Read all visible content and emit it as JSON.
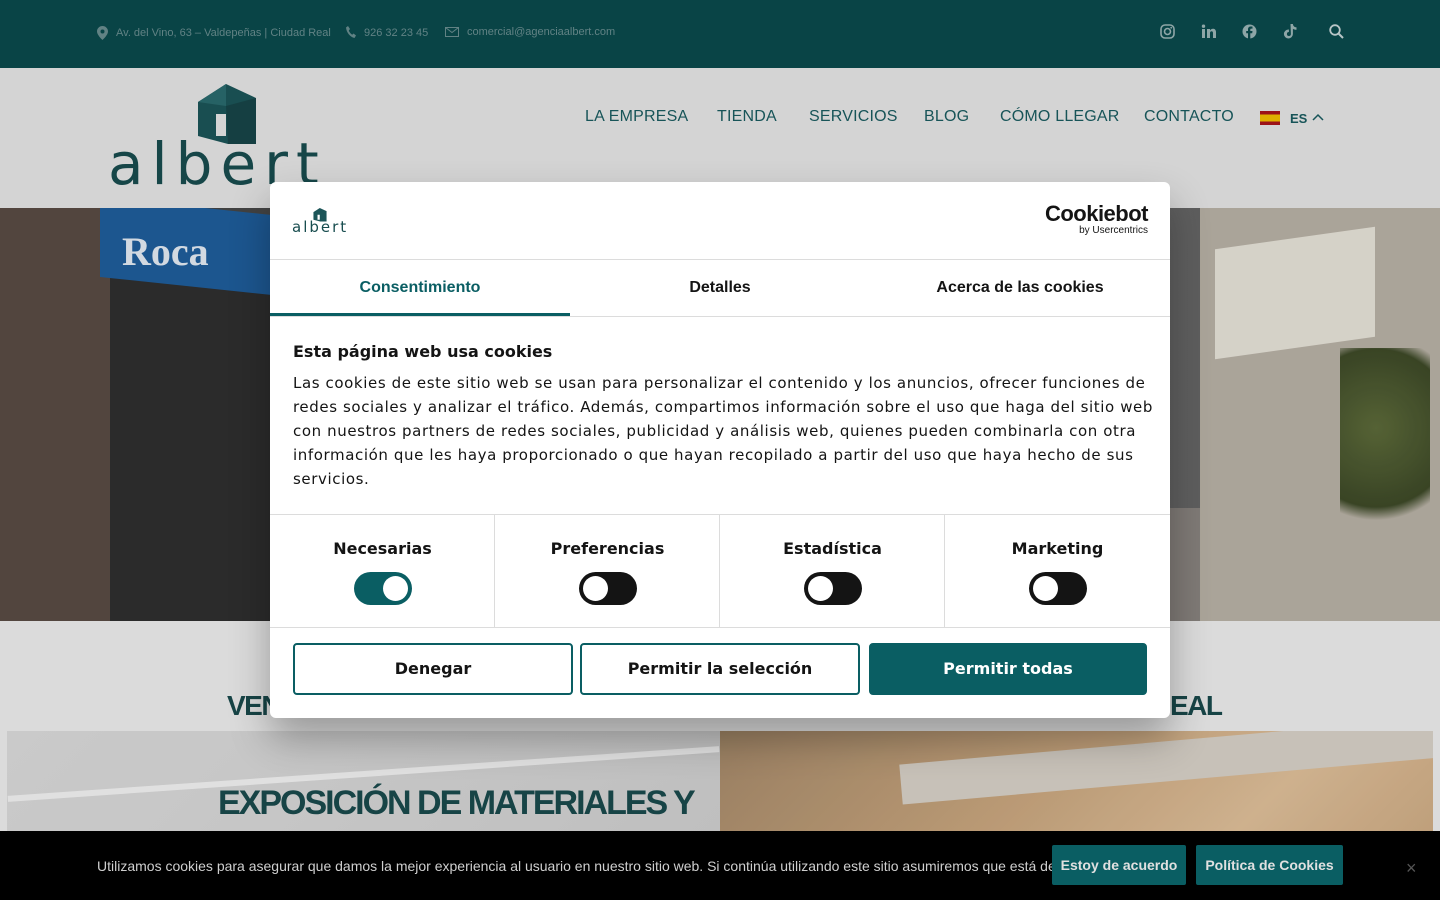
{
  "topbar": {
    "address": "Av. del Vino, 63 – Valdepeñas | Ciudad Real",
    "phone": "926 32 23 45",
    "email": "comercial@agenciaalbert.com",
    "social_icons": [
      "instagram-icon",
      "linkedin-icon",
      "facebook-icon",
      "tiktok-icon",
      "search-icon"
    ]
  },
  "header": {
    "logo_text": "albert",
    "nav": [
      "LA EMPRESA",
      "TIENDA",
      "SERVICIOS",
      "BLOG",
      "CÓMO LLEGAR",
      "CONTACTO"
    ],
    "language": "ES"
  },
  "hero": {
    "sign_text": "Roca"
  },
  "section": {
    "title_left": "VEN",
    "title_right": "EAL",
    "tile_title": "EXPOSICIÓN DE MATERIALES Y"
  },
  "dialog": {
    "logo_text": "albert",
    "brand_main": "Cookiebot",
    "brand_sub": "by Usercentrics",
    "tabs": [
      "Consentimiento",
      "Detalles",
      "Acerca de las cookies"
    ],
    "active_tab": 0,
    "heading": "Esta página web usa cookies",
    "body": "Las cookies de este sitio web se usan para personalizar el contenido y los anuncios, ofrecer funciones de redes sociales y analizar el tráfico. Además, compartimos información sobre el uso que haga del sitio web con nuestros partners de redes sociales, publicidad y análisis web, quienes pueden combinarla con otra información que les haya proporcionado o que hayan recopilado a partir del uso que haya hecho de sus servicios.",
    "categories": [
      {
        "label": "Necesarias",
        "enabled": true
      },
      {
        "label": "Preferencias",
        "enabled": false
      },
      {
        "label": "Estadística",
        "enabled": false
      },
      {
        "label": "Marketing",
        "enabled": false
      }
    ],
    "buttons": {
      "deny": "Denegar",
      "allow_selection": "Permitir la selección",
      "allow_all": "Permitir todas"
    }
  },
  "notice": {
    "text": "Utilizamos cookies para asegurar que damos la mejor experiencia al usuario en nuestro sitio web. Si continúa utilizando este sitio asumiremos que está de acuerdo.",
    "accept": "Estoy de acuerdo",
    "policy": "Política de Cookies",
    "close": "×"
  },
  "colors": {
    "brand_teal": "#0a5e63",
    "topbar_bg": "#0a4a4d",
    "nav_text": "#1a5c60"
  }
}
